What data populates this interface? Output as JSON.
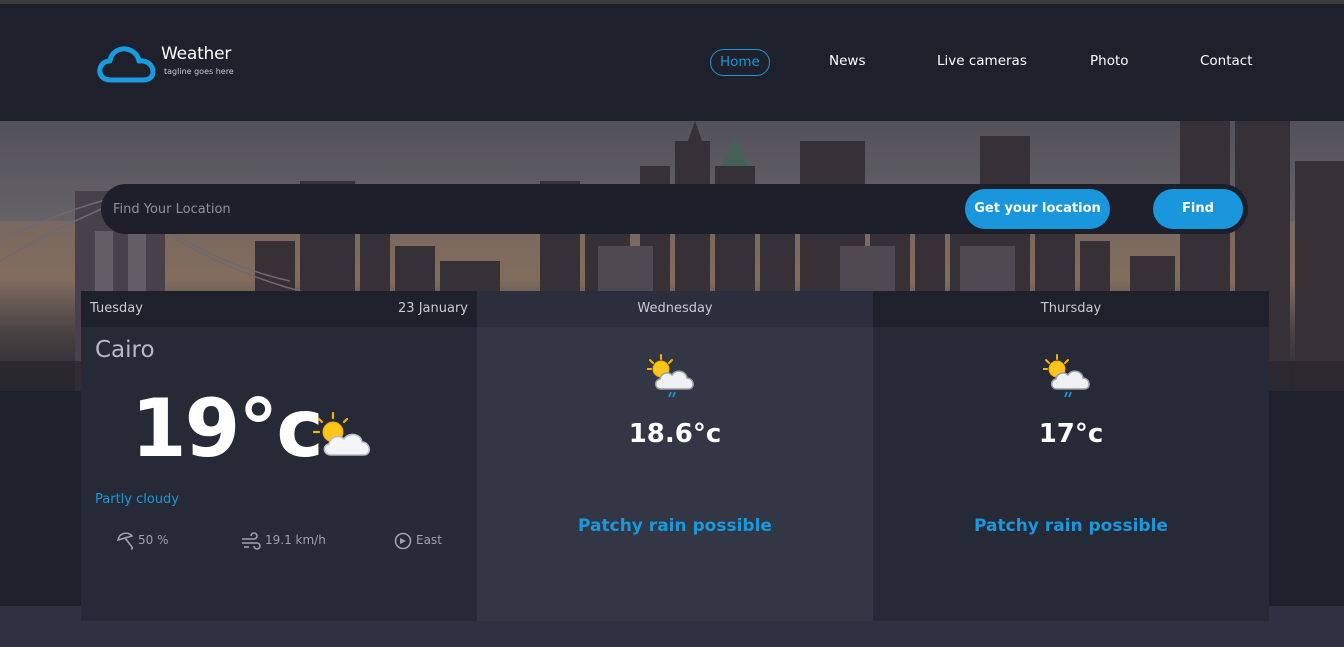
{
  "brand": {
    "title": "Weather",
    "tagline": "tagline goes here",
    "logo_icon": "cloud-icon",
    "accent": "#1a98dc"
  },
  "nav": {
    "items": [
      {
        "label": "Home",
        "active": true
      },
      {
        "label": "News",
        "active": false
      },
      {
        "label": "Live cameras",
        "active": false
      },
      {
        "label": "Photo",
        "active": false
      },
      {
        "label": "Contact",
        "active": false
      }
    ]
  },
  "search": {
    "placeholder": "Find Your Location",
    "value": "",
    "location_button": "Get your location",
    "find_button": "Find"
  },
  "today": {
    "day": "Tuesday",
    "date": "23 January",
    "city": "Cairo",
    "temp": "19°c",
    "condition": "Partly cloudy",
    "icon": "partly-cloudy-icon",
    "humidity": "50 %",
    "wind_speed": "19.1 km/h",
    "wind_dir": "East"
  },
  "forecast": [
    {
      "day": "Wednesday",
      "temp": "18.6°c",
      "condition": "Patchy rain possible",
      "icon": "patchy-rain-icon"
    },
    {
      "day": "Thursday",
      "temp": "17°c",
      "condition": "Patchy rain possible",
      "icon": "patchy-rain-icon"
    }
  ]
}
